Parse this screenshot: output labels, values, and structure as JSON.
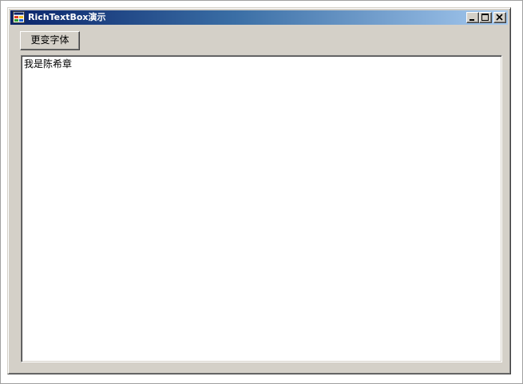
{
  "window": {
    "title": "RichTextBox演示",
    "icon": "windows-form-icon",
    "controls": {
      "minimize_icon": "minimize-icon",
      "maximize_icon": "maximize-icon",
      "close_icon": "close-icon"
    },
    "titlebar_colors": [
      "#0a246a",
      "#a6caf0"
    ],
    "face_color": "#d4d0c8"
  },
  "toolbar": {
    "change_font_label": "更变字体"
  },
  "editor": {
    "content": "我是陈希章"
  }
}
